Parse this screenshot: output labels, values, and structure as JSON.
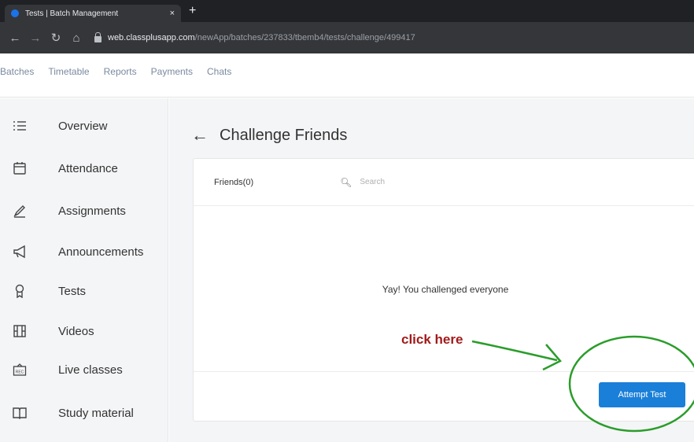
{
  "browser": {
    "tab_title": "Tests | Batch Management",
    "tab_close": "×",
    "new_tab": "+",
    "url_host": "web.classplusapp.com",
    "url_path": "/newApp/batches/237833/tbemb4/tests/challenge/499417"
  },
  "topnav": {
    "items": [
      "Batches",
      "Timetable",
      "Reports",
      "Payments",
      "Chats"
    ]
  },
  "sidebar": {
    "items": [
      {
        "label": "Overview",
        "icon": "list-icon"
      },
      {
        "label": "Attendance",
        "icon": "calendar-icon"
      },
      {
        "label": "Assignments",
        "icon": "pencil-icon"
      },
      {
        "label": "Announcements",
        "icon": "megaphone-icon"
      },
      {
        "label": "Tests",
        "icon": "badge-icon"
      },
      {
        "label": "Videos",
        "icon": "film-icon"
      },
      {
        "label": "Live classes",
        "icon": "rec-icon"
      },
      {
        "label": "Study material",
        "icon": "book-icon"
      }
    ]
  },
  "main": {
    "title": "Challenge Friends",
    "friends_label": "Friends(0)",
    "search_placeholder": "Search",
    "empty_message": "Yay! You challenged everyone",
    "attempt_button": "Attempt Test"
  },
  "annotation": {
    "text": "click here",
    "color": "#a21a1a",
    "highlight_color": "#2a9d2a"
  },
  "colors": {
    "accent": "#1a7fd8"
  }
}
